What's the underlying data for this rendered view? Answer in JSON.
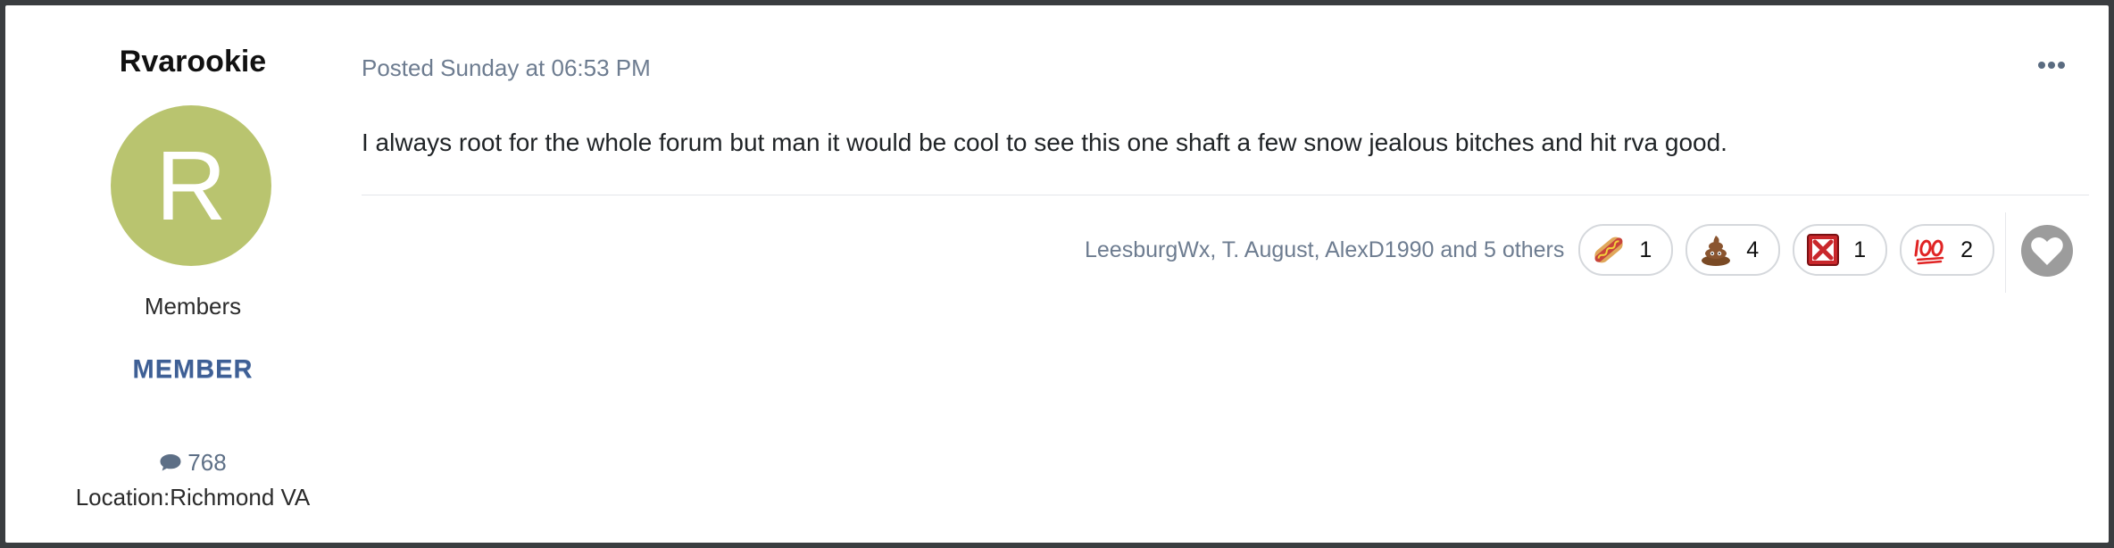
{
  "author": {
    "name": "Rvarookie",
    "avatar_letter": "R",
    "avatar_color": "#b9c46f",
    "group": "Members",
    "rank": "MEMBER",
    "post_count": "768",
    "location": "Location:Richmond VA"
  },
  "post": {
    "meta": "Posted Sunday at 06:53 PM",
    "body": "I always root for the whole forum but man it would be cool to see this one shaft a few snow jealous bitches and hit rva good."
  },
  "reactions": {
    "reactors": "LeesburgWx, T. August, AlexD1990 and 5 others",
    "items": [
      {
        "icon": "hotdog-icon",
        "count": "1"
      },
      {
        "icon": "poop-icon",
        "count": "4"
      },
      {
        "icon": "red-x-icon",
        "count": "1"
      },
      {
        "icon": "hundred-icon",
        "count": "2"
      }
    ]
  },
  "colors": {
    "accent_badge": "#3e5f95",
    "meta_text": "#6d7c90",
    "like_button": "#9c9c9c"
  }
}
